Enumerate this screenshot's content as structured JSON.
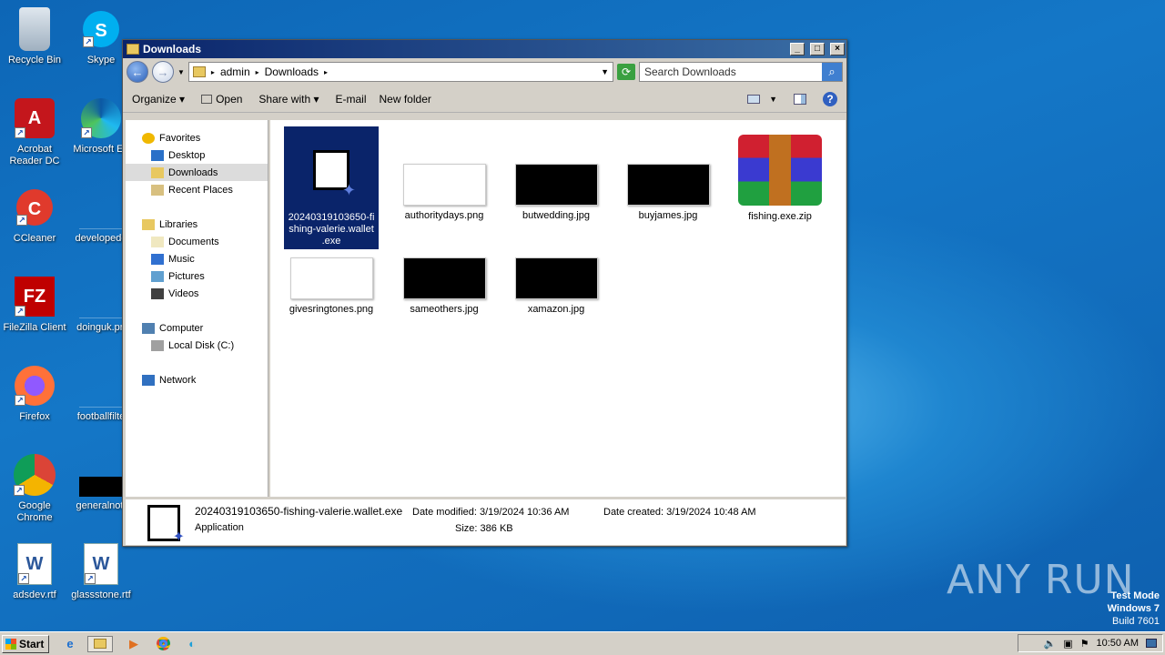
{
  "desktop": {
    "icons": [
      {
        "label": "Recycle Bin",
        "icon": "recycle-bin-icon"
      },
      {
        "label": "Skype",
        "icon": "skype-icon"
      },
      {
        "label": "Acrobat Reader DC",
        "icon": "acrobat-icon"
      },
      {
        "label": "Microsoft Ed",
        "icon": "edge-icon"
      },
      {
        "label": "CCleaner",
        "icon": "ccleaner-icon"
      },
      {
        "label": "developedd",
        "icon": "file-icon"
      },
      {
        "label": "FileZilla Client",
        "icon": "filezilla-icon"
      },
      {
        "label": "doinguk.pn",
        "icon": "file-icon"
      },
      {
        "label": "Firefox",
        "icon": "firefox-icon"
      },
      {
        "label": "footballfilte",
        "icon": "file-icon"
      },
      {
        "label": "Google Chrome",
        "icon": "chrome-icon"
      },
      {
        "label": "generalnot.",
        "icon": "file-icon"
      },
      {
        "label": "adsdev.rtf",
        "icon": "word-doc-icon"
      },
      {
        "label": "glassstone.rtf",
        "icon": "word-doc-icon"
      }
    ]
  },
  "window": {
    "title": "Downloads",
    "controls": {
      "minimize": "_",
      "maximize": "□",
      "close": "×"
    },
    "breadcrumb": [
      "admin",
      "Downloads"
    ],
    "search_placeholder": "Search Downloads",
    "toolbar": {
      "organize": "Organize",
      "open": "Open",
      "share_with": "Share with",
      "email": "E-mail",
      "new_folder": "New folder"
    },
    "nav": [
      {
        "label": "Favorites",
        "level": 0,
        "icon": "star-icon"
      },
      {
        "label": "Desktop",
        "level": 1,
        "icon": "desktop-icon"
      },
      {
        "label": "Downloads",
        "level": 1,
        "icon": "downloads-folder-icon",
        "selected": true
      },
      {
        "label": "Recent Places",
        "level": 1,
        "icon": "recent-places-icon"
      },
      {
        "label": "Libraries",
        "level": 0,
        "icon": "libraries-icon"
      },
      {
        "label": "Documents",
        "level": 1,
        "icon": "documents-icon"
      },
      {
        "label": "Music",
        "level": 1,
        "icon": "music-icon"
      },
      {
        "label": "Pictures",
        "level": 1,
        "icon": "pictures-icon"
      },
      {
        "label": "Videos",
        "level": 1,
        "icon": "videos-icon"
      },
      {
        "label": "Computer",
        "level": 0,
        "icon": "computer-icon"
      },
      {
        "label": "Local Disk (C:)",
        "level": 1,
        "icon": "disk-icon"
      },
      {
        "label": "Network",
        "level": 0,
        "icon": "network-icon"
      }
    ],
    "files": [
      {
        "name": "20240319103650-fishing-valerie.wallet.exe",
        "display": "20240319103650-fi shing-valerie.wallet .exe",
        "type": "exe",
        "selected": true
      },
      {
        "name": "authoritydays.png",
        "type": "white"
      },
      {
        "name": "butwedding.jpg",
        "type": "black"
      },
      {
        "name": "buyjames.jpg",
        "type": "black"
      },
      {
        "name": "fishing.exe.zip",
        "type": "zip"
      },
      {
        "name": "givesringtones.png",
        "type": "white"
      },
      {
        "name": "sameothers.jpg",
        "type": "black"
      },
      {
        "name": "xamazon.jpg",
        "type": "black"
      }
    ],
    "details": {
      "filename": "20240319103650-fishing-valerie.wallet.exe",
      "type": "Application",
      "modified_label": "Date modified:",
      "modified": "3/19/2024 10:36 AM",
      "created_label": "Date created:",
      "created": "3/19/2024 10:48 AM",
      "size_label": "Size:",
      "size": "386 KB"
    }
  },
  "taskbar": {
    "start": "Start",
    "clock": "10:50 AM"
  },
  "watermark": {
    "line1": "Test Mode",
    "line2": "Windows 7",
    "line3": "Build 7601"
  },
  "brand": "ANY RUN"
}
